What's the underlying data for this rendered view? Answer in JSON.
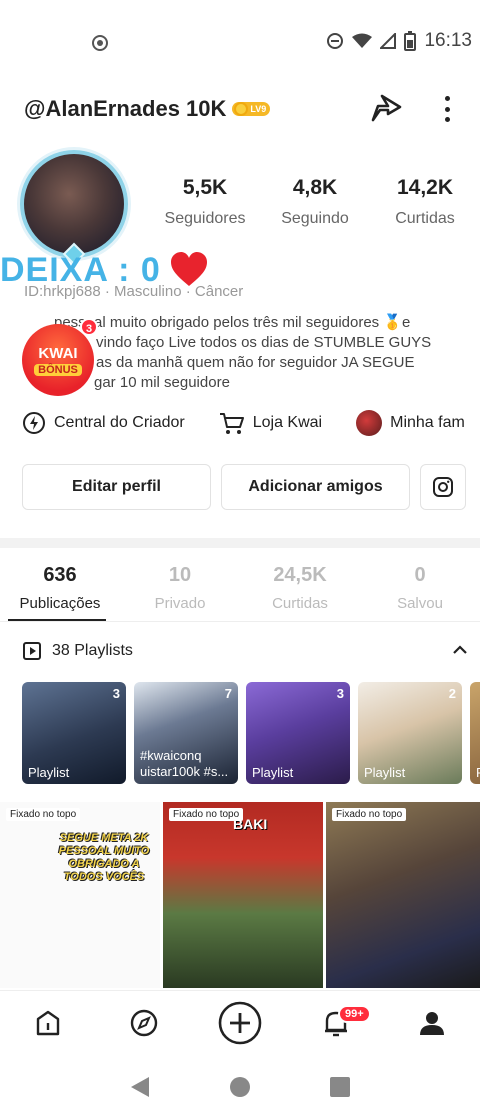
{
  "status_bar": {
    "time": "16:13",
    "icons": [
      "screen-record-icon",
      "do-not-disturb-icon",
      "wifi-icon",
      "signal-icon",
      "battery-icon"
    ]
  },
  "header": {
    "username": "@AlanErnades 10K",
    "level": "LV9"
  },
  "profile": {
    "status": "DEIXA : 0",
    "id_line": "ID:hrkpj688 · Masculino · Câncer",
    "bio": "✨ pessoal muito obrigado pelos três mil seguidores 🥇e ... vindo faço Live todos os dias de STUMBLE GUYS ... as da manhã quem não for seguidor JA SEGUE B... gar 10 mil seguidore",
    "bio_lines": [
      "pessoal muito obrigado pelos três mil seguidores 🥇e",
      "vindo faço Live todos os dias de STUMBLE GUYS",
      "as da manhã quem não for seguidor JA SEGUE",
      "gar 10 mil seguidore"
    ]
  },
  "stats": [
    {
      "value": "5,5K",
      "label": "Seguidores"
    },
    {
      "value": "4,8K",
      "label": "Seguindo"
    },
    {
      "value": "14,2K",
      "label": "Curtidas"
    }
  ],
  "kwai_badge": {
    "title": "KWAI",
    "subtitle": "BÔNUS",
    "count": "3"
  },
  "links": [
    {
      "label": "Central do Criador",
      "icon": "lightning-icon"
    },
    {
      "label": "Loja Kwai",
      "icon": "cart-icon"
    },
    {
      "label": "Minha fam",
      "icon": "family-avatar-icon"
    }
  ],
  "buttons": {
    "edit": "Editar perfil",
    "add_friends": "Adicionar amigos"
  },
  "tabs": [
    {
      "value": "636",
      "label": "Publicações",
      "active": true
    },
    {
      "value": "10",
      "label": "Privado"
    },
    {
      "value": "24,5K",
      "label": "Curtidas"
    },
    {
      "value": "0",
      "label": "Salvou"
    }
  ],
  "playlists": {
    "header": "38 Playlists",
    "items": [
      {
        "count": "3",
        "label": "Playlist"
      },
      {
        "count": "7",
        "label": "#kwaicong\nuistar100k #s..."
      },
      {
        "count": "3",
        "label": "Playlist"
      },
      {
        "count": "2",
        "label": "Playlist"
      },
      {
        "count": "",
        "label": "P"
      }
    ]
  },
  "posts": [
    {
      "pin": "Fixado no topo",
      "title": "SEGUE META 2K PESSOAL MUITO OBRIGADO A TODOS VOCÊS"
    },
    {
      "pin": "Fixado no topo",
      "title": "BAKI"
    },
    {
      "pin": "Fixado no topo",
      "title": ""
    }
  ],
  "bottom_nav": {
    "notifications": "99+"
  },
  "colors": {
    "accent": "#45b3e6",
    "badge_red": "#ff2d3c",
    "level_gold": "#f5b826"
  }
}
